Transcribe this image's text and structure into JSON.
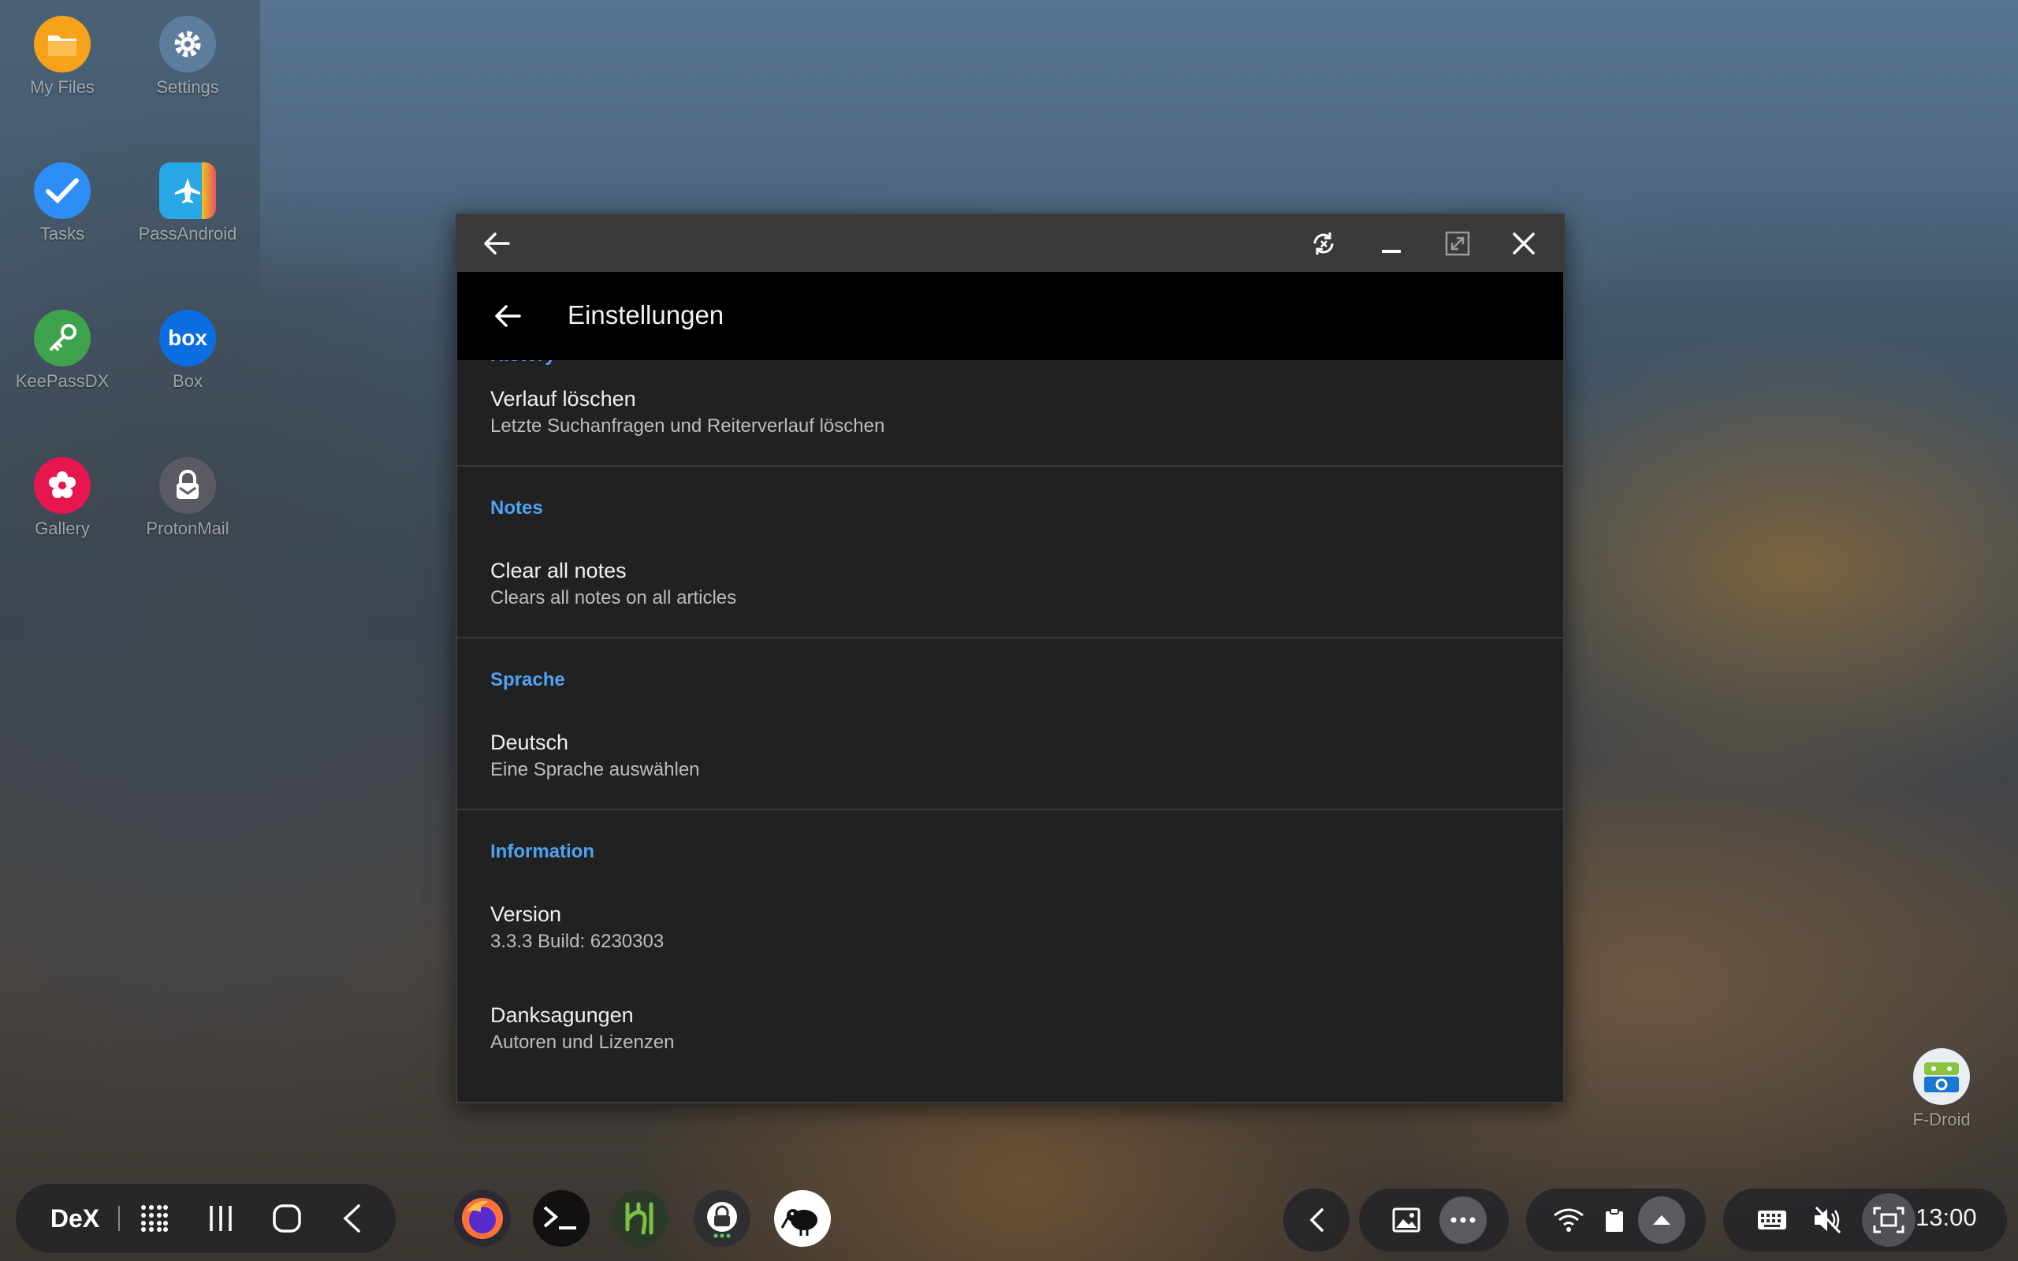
{
  "desktop_icons": [
    {
      "label": "My Files",
      "icon": "folder-icon",
      "color": "#f7a21b"
    },
    {
      "label": "Settings",
      "icon": "gear-icon",
      "color": "#5c7d9e"
    },
    {
      "label": "Tasks",
      "icon": "checkmark-icon",
      "color": "#2f8ef5"
    },
    {
      "label": "PassAndroid",
      "icon": "airplane-ticket-icon",
      "color": "#2aa7e6"
    },
    {
      "label": "KeePassDX",
      "icon": "key-icon",
      "color": "#3fa34d"
    },
    {
      "label": "Box",
      "icon": "box-logo-icon",
      "color": "#0a6ee0"
    },
    {
      "label": "Gallery",
      "icon": "flower-icon",
      "color": "#e8164f"
    },
    {
      "label": "ProtonMail",
      "icon": "lock-icon",
      "color": "#5a5a63"
    },
    {
      "label": "F-Droid",
      "icon": "fdroid-robot-icon",
      "color": "#8ac33e"
    }
  ],
  "window": {
    "appbar_title": "Einstellungen",
    "cut_section_header": "History",
    "sections": {
      "notes_header": "Notes",
      "language_header": "Sprache",
      "info_header": "Information"
    },
    "items": {
      "clear_history_title": "Verlauf löschen",
      "clear_history_summary": "Letzte Suchanfragen und Reiterverlauf löschen",
      "clear_notes_title": "Clear all notes",
      "clear_notes_summary": "Clears all notes on all articles",
      "language_title": "Deutsch",
      "language_summary": "Eine Sprache auswählen",
      "version_title": "Version",
      "version_summary": "3.3.3 Build: 6230303",
      "credits_title": "Danksagungen",
      "credits_summary": "Autoren und Lizenzen"
    }
  },
  "taskbar": {
    "dex_label": "DeX",
    "clock": "13:00",
    "dock_apps": [
      "firefox-icon",
      "terminal-icon",
      "tasker-icon",
      "proton-chat-icon",
      "kiwix-icon"
    ]
  },
  "colors": {
    "accent": "#4fa3f3",
    "window_bg": "#212121",
    "appbar_bg": "#000000",
    "titlebar_bg": "#3a3a3a"
  }
}
